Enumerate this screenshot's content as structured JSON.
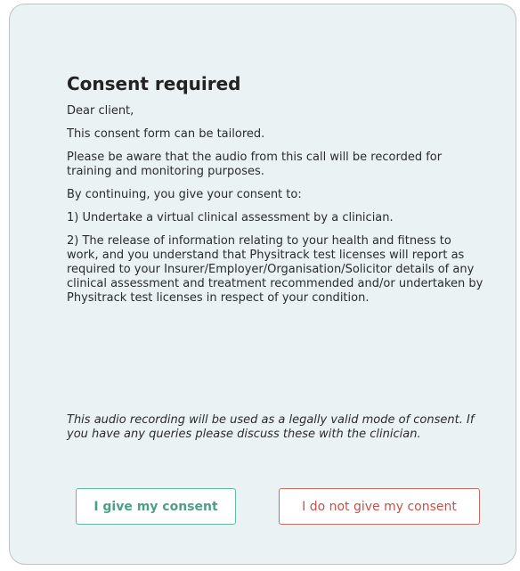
{
  "dialog": {
    "title": "Consent required",
    "paragraphs": [
      "Dear client,",
      "This consent form can be tailored.",
      "Please be aware that the audio from this call will be recorded for training and monitoring purposes.",
      "By continuing, you give your consent to:",
      "1) Undertake a virtual clinical assessment by a clinician.",
      "2) The release of information relating to your health and fitness to work, and you understand that Physitrack test licenses will report as required to your Insurer/Employer/Organisation/Solicitor details of any clinical assessment and treatment recommended and/or undertaken by Physitrack test licenses in respect of your condition."
    ],
    "note": "This audio recording will be used as a legally valid mode of consent. If you have any queries please discuss these with the clinician.",
    "consent_button": "I give my consent",
    "decline_button": "I do not give my consent"
  },
  "colors": {
    "dialog_background": "#ebf2f3",
    "consent_accent": "#4c9f88",
    "decline_accent": "#c0524a"
  }
}
